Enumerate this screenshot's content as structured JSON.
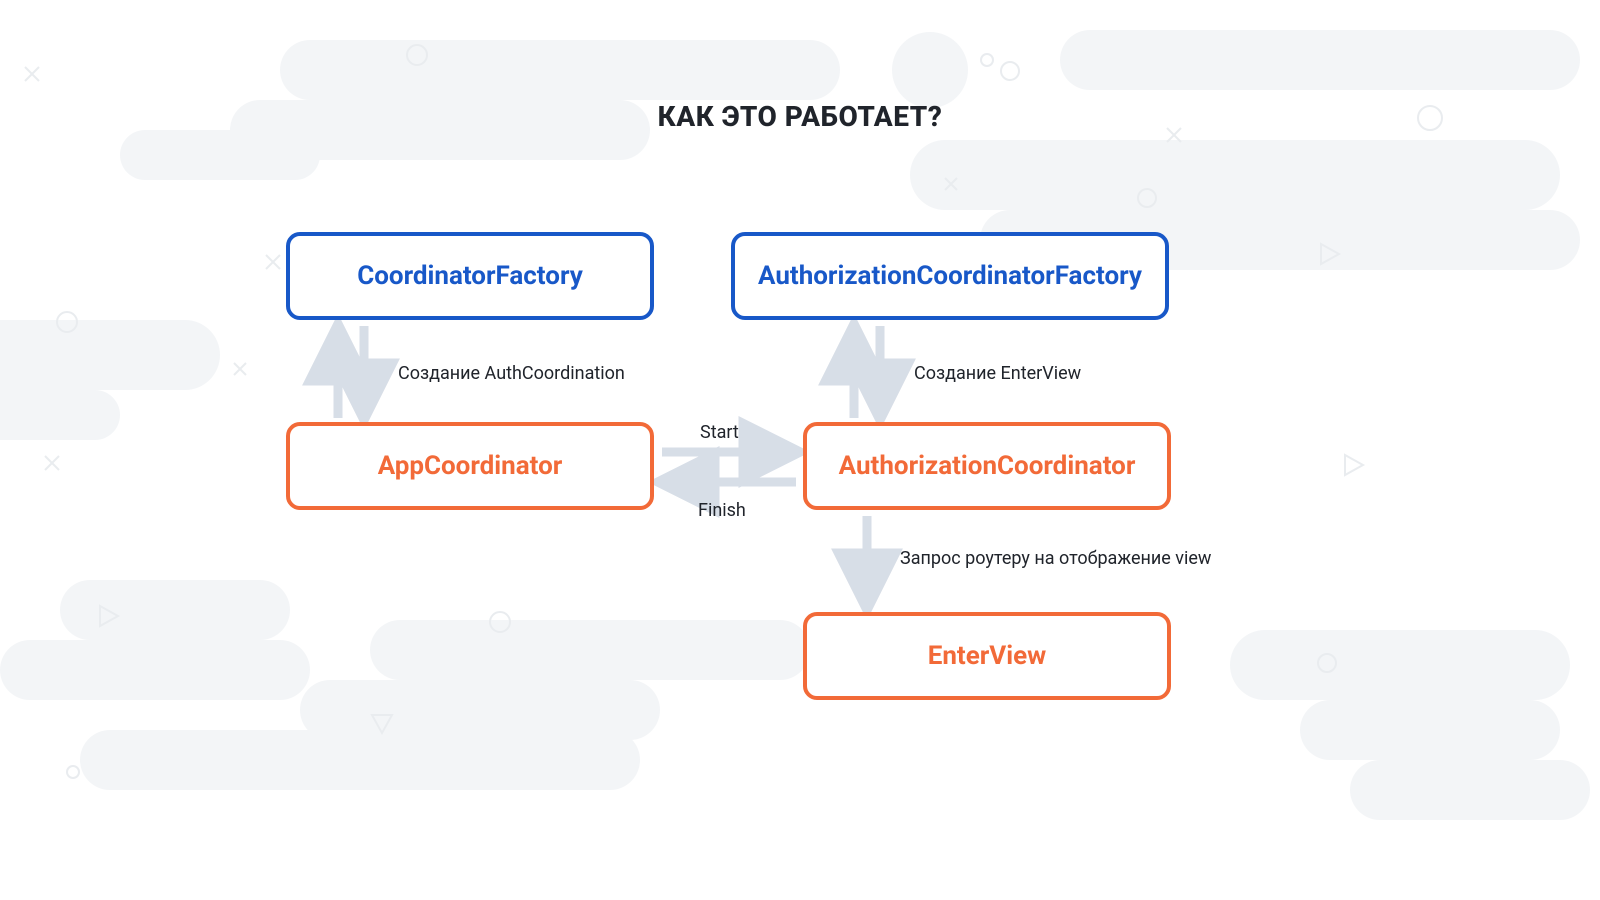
{
  "title": "КАК ЭТО РАБОТАЕТ?",
  "boxes": {
    "coordFactory": "CoordinatorFactory",
    "authCoordFactory": "AuthorizationCoordinatorFactory",
    "appCoord": "AppCoordinator",
    "authCoord": "AuthorizationCoordinator",
    "enterView": "EnterView"
  },
  "labels": {
    "createAuthCoord": "Создание AuthCoordination",
    "createEnterView": "Создание EnterView",
    "start": "Start",
    "finish": "Finish",
    "routerRequest": "Запрос роутеру на отображение view"
  },
  "colors": {
    "blue": "#1858c8",
    "orange": "#f26a38",
    "arrow": "#d7dee7",
    "text": "#20242b",
    "bg": "#f3f5f7",
    "bgStroke": "#e9ecef"
  }
}
